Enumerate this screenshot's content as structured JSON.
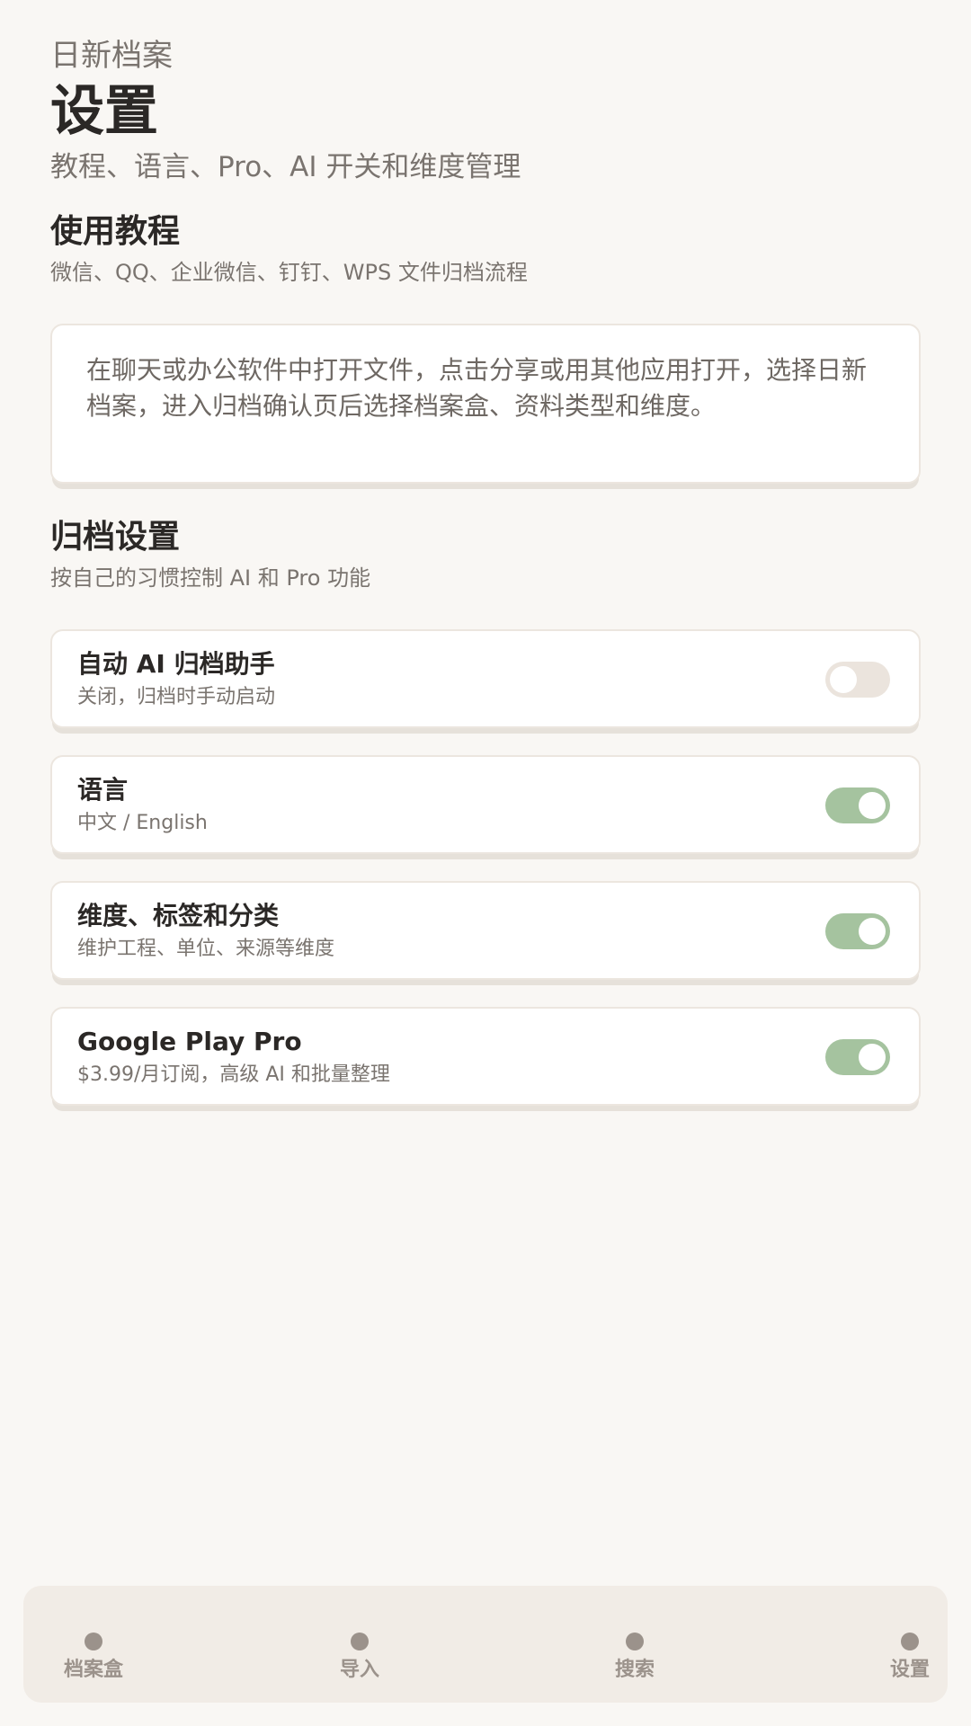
{
  "header": {
    "app_name": "日新档案",
    "title": "设置",
    "subtitle": "教程、语言、Pro、AI 开关和维度管理"
  },
  "tutorial": {
    "title": "使用教程",
    "subtitle": "微信、QQ、企业微信、钉钉、WPS 文件归档流程",
    "body": "在聊天或办公软件中打开文件，点击分享或用其他应用打开，选择日新档案，进入归档确认页后选择档案盒、资料类型和维度。"
  },
  "archive_settings": {
    "title": "归档设置",
    "subtitle": "按自己的习惯控制 AI 和 Pro 功能",
    "rows": [
      {
        "title": "自动 AI 归档助手",
        "subtitle": "关闭，归档时手动启动",
        "toggle": "off"
      },
      {
        "title": "语言",
        "subtitle": "中文 / English",
        "toggle": "on"
      },
      {
        "title": "维度、标签和分类",
        "subtitle": "维护工程、单位、来源等维度",
        "toggle": "on"
      },
      {
        "title": "Google Play Pro",
        "subtitle": "$3.99/月订阅，高级 AI 和批量整理",
        "toggle": "on"
      }
    ]
  },
  "bottom_nav": {
    "items": [
      {
        "label": "档案盒",
        "icon": "dot-icon"
      },
      {
        "label": "导入",
        "icon": "dot-icon"
      },
      {
        "label": "搜索",
        "icon": "dot-icon"
      },
      {
        "label": "设置",
        "icon": "dot-icon"
      }
    ]
  },
  "colors": {
    "background": "#f9f7f4",
    "toggle_on": "#a5c39f",
    "toggle_off": "#ebe4dd",
    "nav_icon": "#9b928b"
  }
}
